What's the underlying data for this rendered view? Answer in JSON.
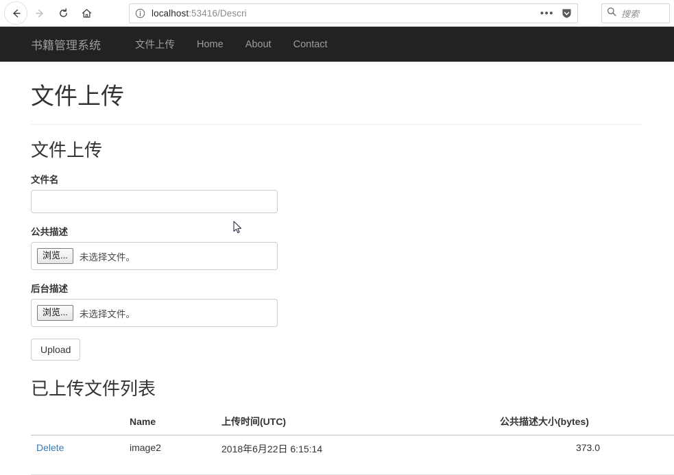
{
  "browser": {
    "back_icon": "back-arrow-icon",
    "forward_icon": "forward-arrow-icon",
    "reload_icon": "reload-icon",
    "home_icon": "home-icon",
    "info_icon": "info-circle-icon",
    "url_host": "localhost",
    "url_rest": ":53416/Descri",
    "page_actions_icon": "ellipsis-icon",
    "reader_icon": "shield-icon",
    "search_icon": "search-icon",
    "search_placeholder": "搜索"
  },
  "navbar": {
    "brand": "书籍管理系统",
    "links": [
      {
        "label": "文件上传"
      },
      {
        "label": "Home"
      },
      {
        "label": "About"
      },
      {
        "label": "Contact"
      }
    ]
  },
  "page": {
    "title": "文件上传",
    "form_section_title": "文件上传",
    "fields": [
      {
        "label": "文件名",
        "type": "text",
        "value": ""
      },
      {
        "label": "公共描述",
        "type": "file",
        "browse_label": "浏览...",
        "status": "未选择文件。"
      },
      {
        "label": "后台描述",
        "type": "file",
        "browse_label": "浏览...",
        "status": "未选择文件。"
      }
    ],
    "upload_button": "Upload",
    "list_title": "已上传文件列表",
    "table": {
      "headers": [
        "",
        "Name",
        "上传时间(UTC)",
        "公共描述大小(bytes)"
      ],
      "rows": [
        {
          "action": "Delete",
          "name": "image2",
          "time": "2018年6月22日 6:15:14",
          "size": "373.0"
        }
      ]
    }
  },
  "colors": {
    "navbar_bg": "#222222",
    "navbar_text": "#9d9d9d",
    "link": "#337ab7",
    "border": "#cccccc"
  }
}
